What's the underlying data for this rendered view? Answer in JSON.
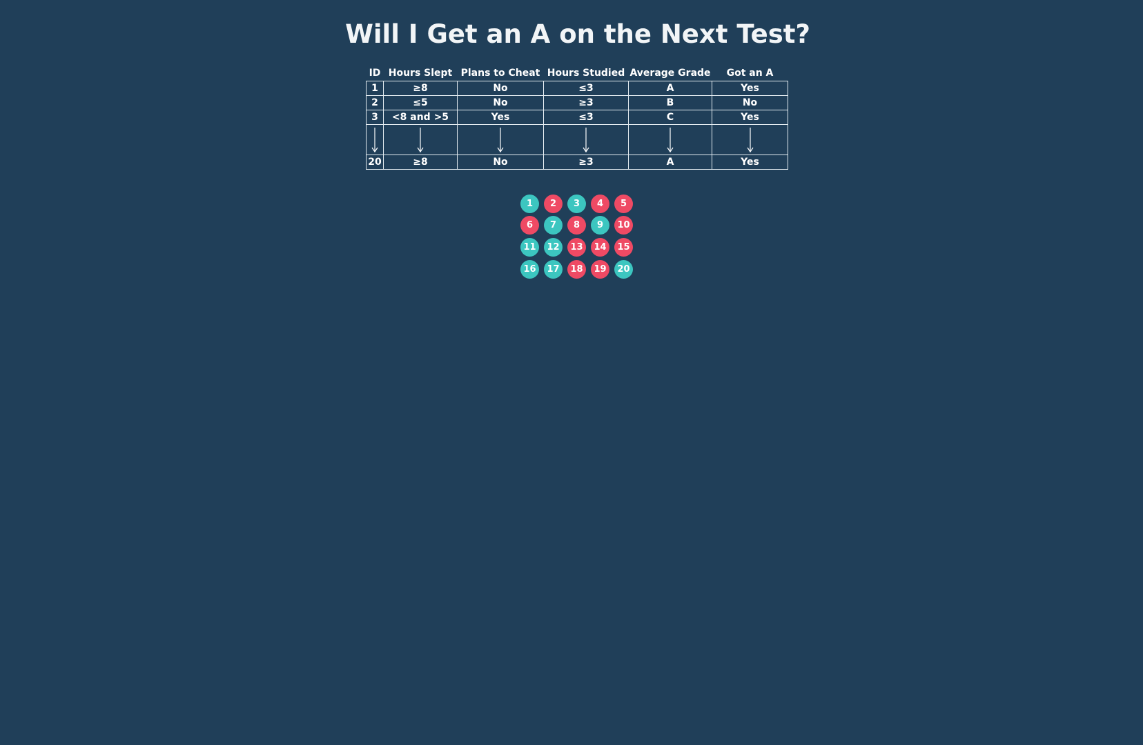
{
  "title": "Will I Get an A on the Next Test?",
  "colors": {
    "background": "#203f59",
    "yes": "#3cc6c0",
    "no": "#ef4a64",
    "border": "#e6eef3"
  },
  "table": {
    "headers": [
      "ID",
      "Hours Slept",
      "Plans to Cheat",
      "Hours Studied",
      "Average Grade",
      "Got an A"
    ],
    "rows": [
      {
        "id": "1",
        "slept": "≥8",
        "cheat": "No",
        "studied": "≤3",
        "grade": "A",
        "got_a": "Yes"
      },
      {
        "id": "2",
        "slept": "≤5",
        "cheat": "No",
        "studied": "≥3",
        "grade": "B",
        "got_a": "No"
      },
      {
        "id": "3",
        "slept": "<8 and >5",
        "cheat": "Yes",
        "studied": "≤3",
        "grade": "C",
        "got_a": "Yes"
      }
    ],
    "last_row": {
      "id": "20",
      "slept": "≥8",
      "cheat": "No",
      "studied": "≥3",
      "grade": "A",
      "got_a": "Yes"
    }
  },
  "circles": [
    {
      "label": "1",
      "status": "yes"
    },
    {
      "label": "2",
      "status": "no"
    },
    {
      "label": "3",
      "status": "yes"
    },
    {
      "label": "4",
      "status": "no"
    },
    {
      "label": "5",
      "status": "no"
    },
    {
      "label": "6",
      "status": "no"
    },
    {
      "label": "7",
      "status": "yes"
    },
    {
      "label": "8",
      "status": "no"
    },
    {
      "label": "9",
      "status": "yes"
    },
    {
      "label": "10",
      "status": "no"
    },
    {
      "label": "11",
      "status": "yes"
    },
    {
      "label": "12",
      "status": "yes"
    },
    {
      "label": "13",
      "status": "no"
    },
    {
      "label": "14",
      "status": "no"
    },
    {
      "label": "15",
      "status": "no"
    },
    {
      "label": "16",
      "status": "yes"
    },
    {
      "label": "17",
      "status": "yes"
    },
    {
      "label": "18",
      "status": "no"
    },
    {
      "label": "19",
      "status": "no"
    },
    {
      "label": "20",
      "status": "yes"
    }
  ]
}
